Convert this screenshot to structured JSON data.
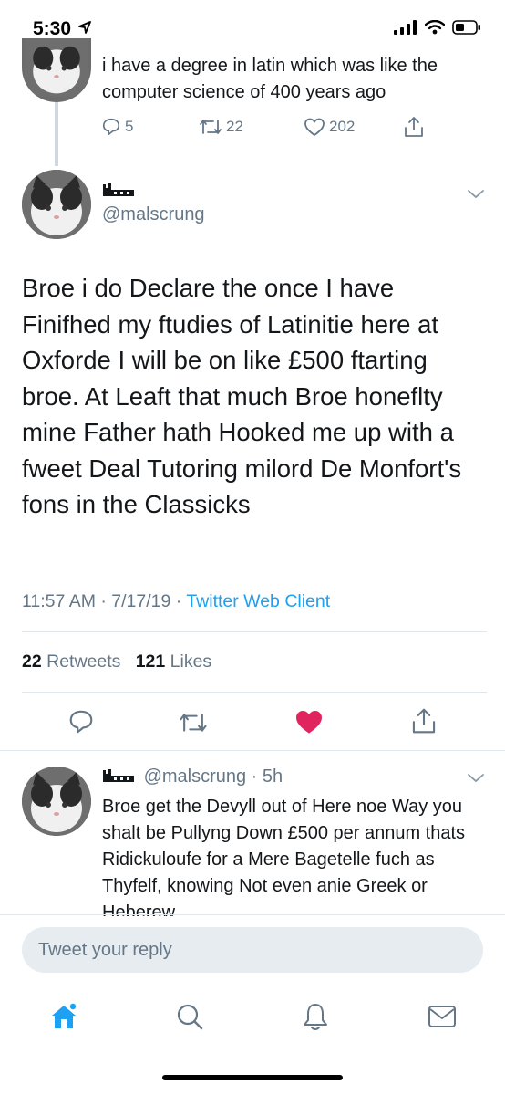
{
  "status_bar": {
    "time": "5:30",
    "location_icon": "location-arrow-icon",
    "signal_icon": "signal-icon",
    "wifi_icon": "wifi-icon",
    "battery_icon": "battery-icon"
  },
  "parent_tweet": {
    "text": "i have a degree in latin which was like the computer science of 400 years ago",
    "replies": "5",
    "retweets": "22",
    "likes": "202"
  },
  "main_tweet": {
    "handle": "@malscrung",
    "text": "Broe i do Declare the once I have Finifhed my ftudies of Latinitie here at Oxforde I will be on like £500 ftarting broe. At Leaft that much Broe honeflty mine Father hath Hooked me up with a fweet Deal Tutoring milord De Monfort's fons in the Classicks",
    "time": "11:57 AM · 7/17/19 · ",
    "client": "Twitter Web Client",
    "retweets_count": "22",
    "retweets_label": "Retweets",
    "likes_count": "121",
    "likes_label": "Likes",
    "liked": true,
    "like_color": "#e0245e"
  },
  "reply_tweet": {
    "handle": "@malscrung",
    "age": " · 5h",
    "text": "Broe get the Devyll out of Here noe Way you shalt be Pullyng Down £500 per annum thats Ridickuloufe for a Mere Bagetelle fuch as Thyfelf, knowing Not even anie Greek or Heberew"
  },
  "composer": {
    "placeholder": "Tweet your reply"
  },
  "colors": {
    "accent": "#1da1f2",
    "secondary_text": "#657786",
    "divider": "#e1e8ed"
  },
  "bottom_nav": [
    "home-icon",
    "search-icon",
    "notifications-bell-icon",
    "messages-envelope-icon"
  ]
}
